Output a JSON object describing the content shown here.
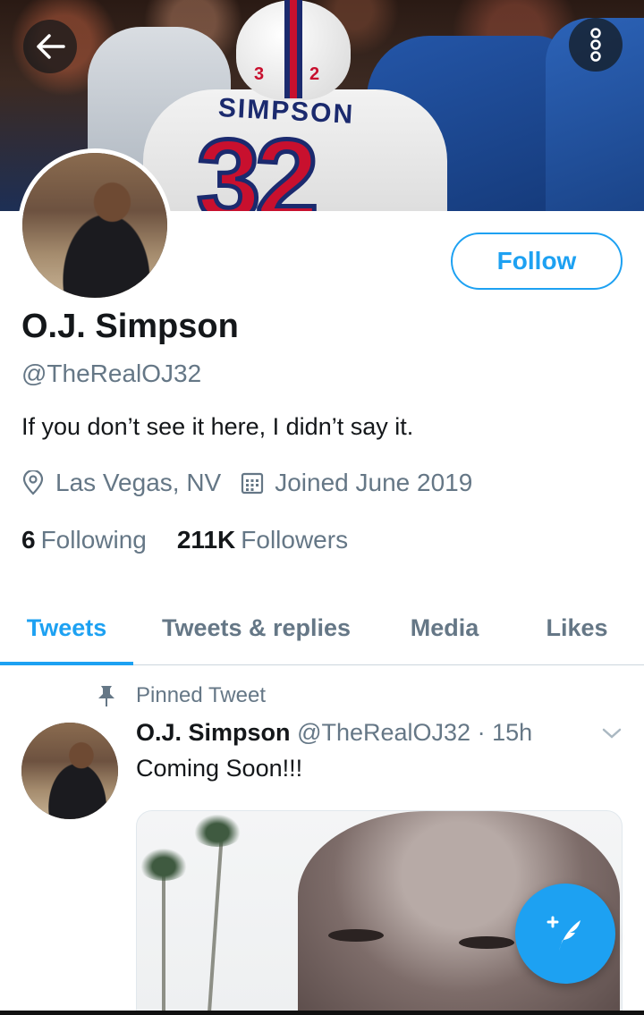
{
  "colors": {
    "accent": "#1da1f2",
    "text": "#14171a",
    "secondary": "#657786"
  },
  "banner": {
    "helmet_numbers": [
      "3",
      "2"
    ],
    "jersey_name": "SIMPSON",
    "jersey_number": "32"
  },
  "profile": {
    "follow_label": "Follow",
    "name": "O.J. Simpson",
    "handle": "@TheRealOJ32",
    "bio": "If you don’t see it here, I didn’t say it.",
    "location": "Las Vegas, NV",
    "joined": "Joined June 2019",
    "following_count": "6",
    "following_label": "Following",
    "followers_count": "211K",
    "followers_label": "Followers"
  },
  "tabs": [
    {
      "label": "Tweets",
      "active": true
    },
    {
      "label": "Tweets & replies",
      "active": false
    },
    {
      "label": "Media",
      "active": false
    },
    {
      "label": "Likes",
      "active": false
    }
  ],
  "tweet": {
    "pinned_label": "Pinned Tweet",
    "author_name": "O.J. Simpson",
    "author_handle": "@TheRealOJ32",
    "time": "· 15h",
    "text": "Coming Soon!!!"
  },
  "icons": {
    "back": "back-arrow-icon",
    "more": "more-options-icon",
    "location": "location-pin-icon",
    "calendar": "calendar-icon",
    "pin": "pin-icon",
    "caret": "chevron-down-icon",
    "compose": "compose-tweet-icon"
  }
}
